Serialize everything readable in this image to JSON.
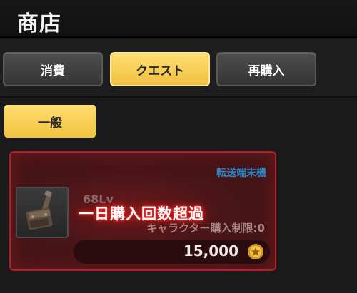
{
  "header": {
    "title": "商店"
  },
  "tabs": [
    {
      "label": "消費",
      "active": false
    },
    {
      "label": "クエスト",
      "active": true
    },
    {
      "label": "再購入",
      "active": false
    }
  ],
  "category_chip": {
    "label": "一般"
  },
  "item_card": {
    "category": "転送端末機",
    "level": "68Lv",
    "purchase_limit": "キャラクター購入制限:0",
    "price": "15,000",
    "overlay": "一日購入回数超過",
    "icon": "hammer-icon",
    "currency_icon": "gold-coin-icon"
  },
  "colors": {
    "accent_yellow": "#f5c84a",
    "card_border_red": "#b0202a",
    "category_blue": "#2f87c8"
  }
}
